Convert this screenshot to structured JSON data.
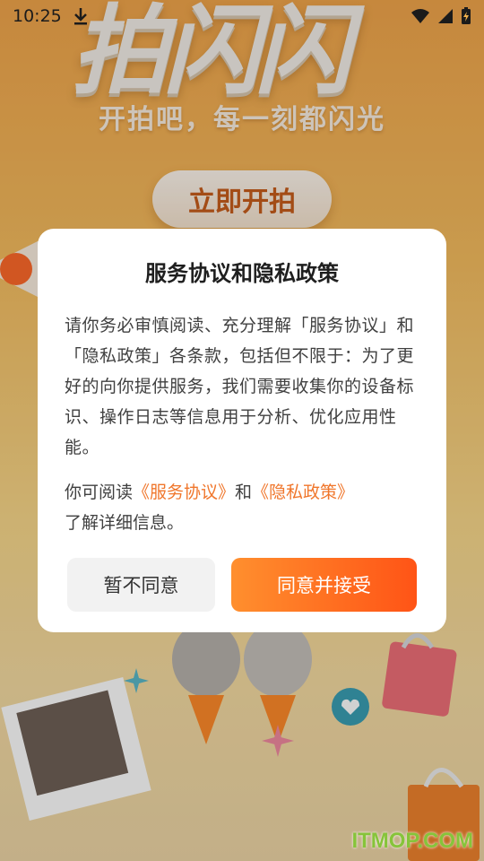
{
  "status_bar": {
    "time": "10:25",
    "icons": [
      "download-icon",
      "wifi-icon",
      "signal-icon",
      "battery-charging-icon"
    ]
  },
  "background": {
    "hero_title": "拍闪闪",
    "hero_subtitle": "开拍吧，每一刻都闪光",
    "hero_button_label": "立即开拍"
  },
  "dialog": {
    "title": "服务协议和隐私政策",
    "body": "请你务必审慎阅读、充分理解「服务协议」和「隐私政策」各条款，包括但不限于：为了更好的向你提供服务，我们需要收集你的设备标识、操作日志等信息用于分析、优化应用性能。",
    "links_prefix": "你可阅读",
    "link_service": "《服务协议》",
    "links_and": "和",
    "link_privacy": "《隐私政策》",
    "links_suffix": "了解详细信息。",
    "decline_label": "暂不同意",
    "accept_label": "同意并接受"
  },
  "watermark": "ITMOP.COM",
  "colors": {
    "accent": "#ff6a1f",
    "link": "#f0762b",
    "watermark": "#86c43a"
  }
}
